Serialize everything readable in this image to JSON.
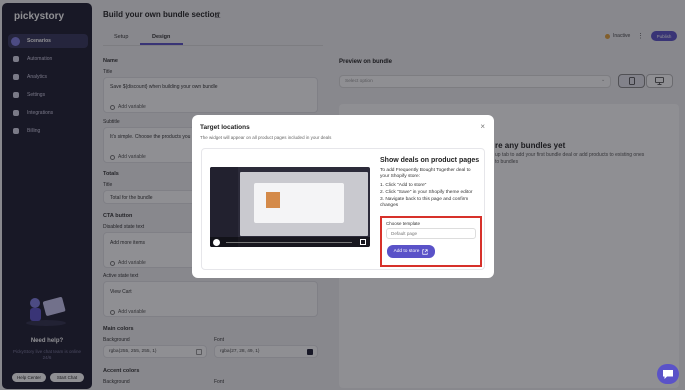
{
  "sidebar": {
    "logo": "pickystory",
    "items": [
      {
        "label": "Scenarios",
        "icon": "scenarios-icon",
        "active": true
      },
      {
        "label": "Automation",
        "icon": "lightning-icon"
      },
      {
        "label": "Analytics",
        "icon": "chart-icon"
      },
      {
        "label": "Settings",
        "icon": "gear-icon"
      },
      {
        "label": "Integrations",
        "icon": "puzzle-icon"
      },
      {
        "label": "Billing",
        "icon": "card-icon"
      }
    ],
    "help": {
      "title": "Need help?",
      "subtitle": "PickyStory live chat team is online 24/6",
      "help_center": "Help Center",
      "start_chat": "Start Chat"
    }
  },
  "header": {
    "title": "Build your own bundle section",
    "tabs": [
      "Setup",
      "Design"
    ],
    "active_tab": "Design",
    "status": "Inactive",
    "publish": "Publish"
  },
  "form": {
    "name_section": "Name",
    "title_label": "Title",
    "title_value": "Save ${discount} when building your own bundle",
    "add_variable": "Add variable",
    "subtitle_label": "Subtitle",
    "subtitle_value": "It's simple. Choose the products you",
    "totals_section": "Totals",
    "totals_title_label": "Title",
    "totals_title_value": "Total for the bundle",
    "cta_section": "CTA button",
    "disabled_label": "Disabled state text",
    "disabled_value": "Add more items",
    "active_label": "Active state text",
    "active_value": "View Cart",
    "main_colors": "Main colors",
    "background_label": "Background",
    "background_value": "rgba(255, 255, 255, 1)",
    "font_label": "Font",
    "font_value": "rgba(27, 28, 49, 1)",
    "accent_colors": "Accent colors",
    "accent_background_label": "Background",
    "accent_font_label": "Font"
  },
  "preview": {
    "title": "Preview on bundle",
    "select_placeholder": "Select option",
    "heading": "re any bundles yet",
    "text_line1": "up tab to add your first bundle deal or add products to existing ones",
    "text_line2": "to bundles"
  },
  "modal": {
    "title": "Target locations",
    "subtitle": "The widget will appear on all product pages included in your deals",
    "deal_title": "Show deals on product pages",
    "deal_intro": "To add Frequently Bought Together deal to your Shopify store:",
    "steps": [
      "1. Click \"Add to store\"",
      "2. Click \"Save\" in your Shopify theme editor",
      "3. Navigate back to this page and confirm changes"
    ],
    "template_label": "Choose template",
    "template_value": "Default page",
    "add_to_store": "Add to store"
  },
  "colors": {
    "accent": "#5a52c8",
    "sidebar": "#1c1b2e",
    "status_inactive": "#e7a33a",
    "highlight": "#d7312a"
  }
}
